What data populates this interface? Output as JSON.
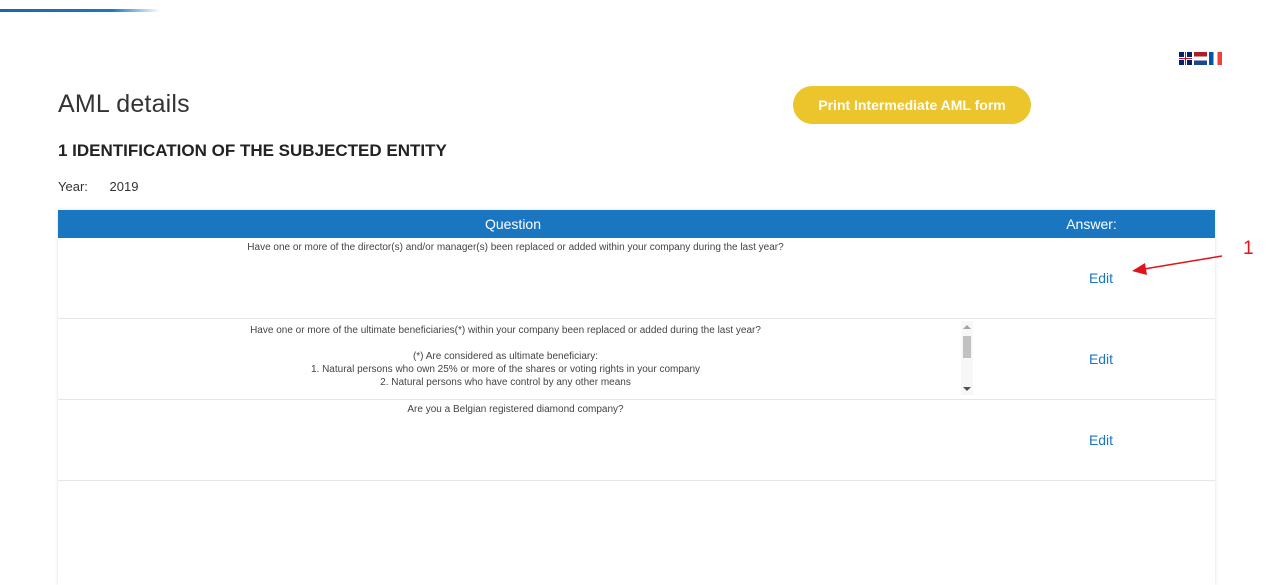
{
  "header": {
    "language_flags": [
      "uk-flag-icon",
      "nl-flag-icon",
      "fr-flag-icon"
    ]
  },
  "page": {
    "title": "AML details",
    "print_button_label": "Print Intermediate AML form",
    "section_title": "1 IDENTIFICATION OF THE SUBJECTED ENTITY",
    "year_label": "Year:",
    "year_value": "2019"
  },
  "table": {
    "columns": {
      "question": "Question",
      "answer": "Answer:"
    },
    "rows": [
      {
        "question_lines": [
          "Have one or more of the director(s) and/or manager(s) been replaced or added within your company during the last year?"
        ],
        "action_label": "Edit"
      },
      {
        "question_lines": [
          "Have one or more of the ultimate beneficiaries(*) within your company been replaced  or added during the last year?",
          "",
          "(*) Are considered as ultimate beneficiary:",
          "1. Natural persons  who own 25% or more of the shares or voting rights in your company",
          "2. Natural persons who  have control by any other means"
        ],
        "action_label": "Edit"
      },
      {
        "question_lines": [
          "Are you a Belgian registered diamond company?"
        ],
        "action_label": "Edit"
      }
    ]
  },
  "annotation": {
    "label": "1",
    "color": "#e0151c"
  },
  "colors": {
    "accent_blue": "#1b76c1",
    "print_button": "#ecc42b"
  }
}
